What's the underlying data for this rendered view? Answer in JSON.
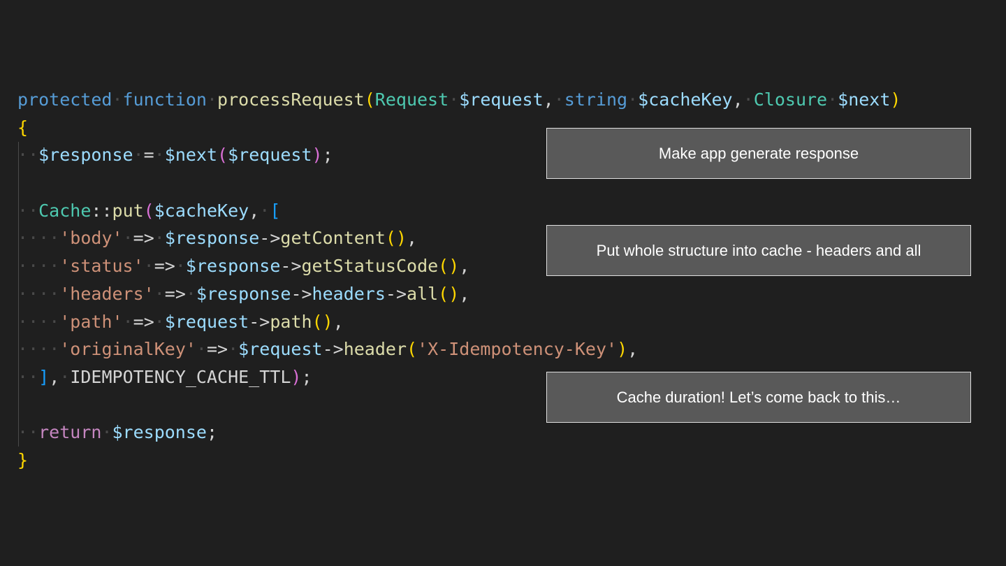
{
  "code": {
    "language": "php",
    "lines": [
      "protected function processRequest(Request $request, string $cacheKey, Closure $next)",
      "{",
      "  $response = $next($request);",
      "",
      "  Cache::put($cacheKey, [",
      "    'body' => $response->getContent(),",
      "    'status' => $response->getStatusCode(),",
      "    'headers' => $response->headers->all(),",
      "    'path' => $request->path(),",
      "    'originalKey' => $request->header('X-Idempotency-Key'),",
      "  ], IDEMPOTENCY_CACHE_TTL);",
      "",
      "  return $response;",
      "}"
    ]
  },
  "annotations": [
    {
      "text": "Make app generate response"
    },
    {
      "text": "Put whole structure into cache - headers and all"
    },
    {
      "text": "Cache duration! Let’s come back to this…"
    }
  ],
  "colors": {
    "background": "#1f1f1f",
    "annotation_fill": "#595959",
    "annotation_border": "#e0e0e0",
    "keyword": "#569cd6",
    "function": "#dcdcaa",
    "type": "#4ec9b0",
    "variable": "#9cdcfe",
    "string": "#ce9178",
    "bracket_level1": "#ffd700",
    "bracket_level2": "#da70d6",
    "bracket_level3": "#179fff"
  }
}
